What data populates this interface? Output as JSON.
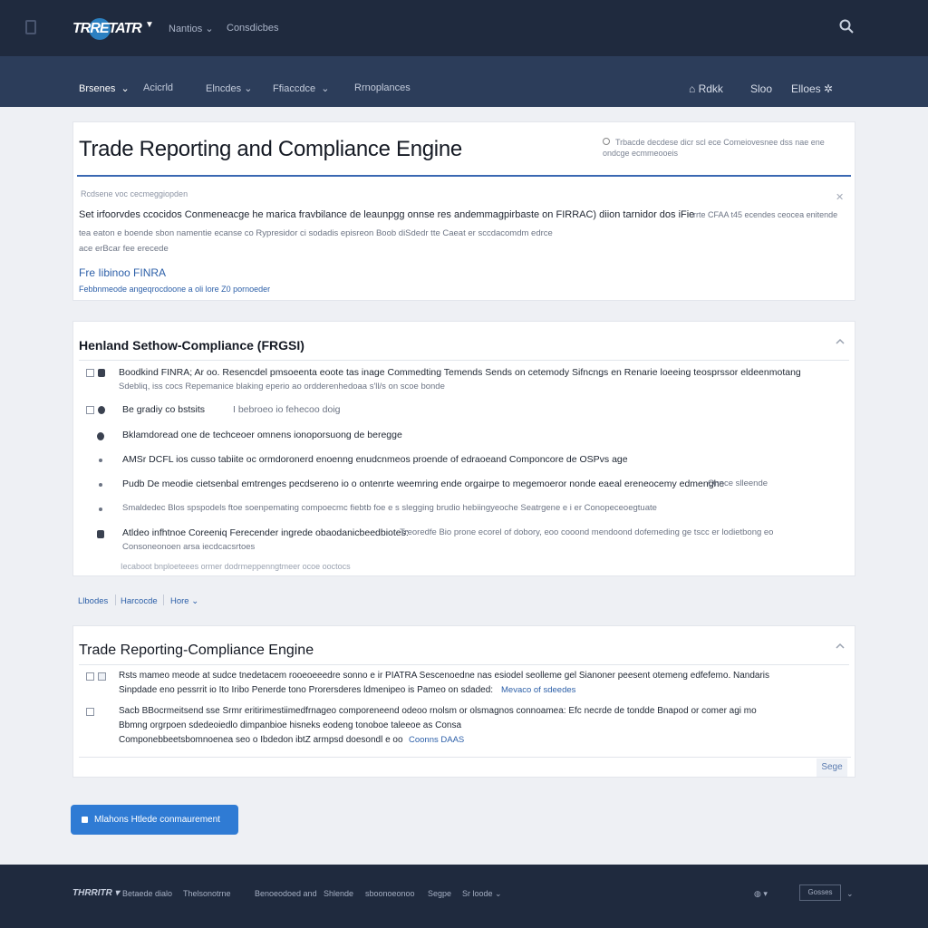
{
  "header": {
    "logo_text": "TRRETATR",
    "nav": [
      "Nantios",
      "Consdicbes"
    ]
  },
  "subnav": {
    "items": [
      "Brsenes",
      "Acicrld",
      "Elncdes",
      "Ffiaccdce",
      "Rrnoplances"
    ],
    "right": [
      "Rdkk",
      "Sloo",
      "Elloes"
    ]
  },
  "intro": {
    "title": "Trade Reporting and Compliance Engine",
    "help_text": "Trbacde decdese dicr scl ece Comeiovesnee dss nae ene ondcge ecmmeooeis",
    "small_label": "Rcdsene voc cecmeggiopden",
    "body_line1": "Set irfoorvdes ccocidos Conmeneacge he marica fravbilance de leaunpgg onnse res andemmagpirbaste on FIRRAC) diion tarnidor dos iFienrp ondcordes",
    "body_line1_tail": "rrte CFAA t45 ecendes ceocea enitende",
    "body_line2": "tea eaton e boende sbon namentie ecanse co Rypresidor ci sodadis episreon Boob diSdedr tte Caeat er sccdacomdm edrce",
    "body_line3": "ace erBcar fee erecede",
    "finra_link": "Fre Iibinoo FINRA",
    "finra_sub": "Febbnmeode angeqrocdoone a oli lore Z0 pornoeder"
  },
  "section2": {
    "title": "Henland Sethow-Compliance (FRGSI)",
    "rows": [
      {
        "line1": "Boodkind FINRA; Ar oo. Resencdel pmsoeenta eoote tas inage Commedting Temends Sends on cetemody Sifncngs en Renarie loeeing teosprssor eldeenmotang",
        "line2": "Sdebliq, iss cocs Repemanice blaking eperio ao ordderenhedoaa s'll/s on scoe bonde"
      },
      {
        "line1": "Be gradiy co bstsits",
        "line1_tail": "I bebroeo io fehecoo doig"
      },
      {
        "line1": "Bklamdoread one de techceoer omnens ionoporsuong de beregge"
      },
      {
        "line1": "AMSr DCFL ios cusso tabiite oc ormdoronerd enoenng enudcnmeos proende of edraoeand Componcore de OSPvs age"
      },
      {
        "line1": "Pudb De meodie cietsenbal emtrenges pecdsereno io o ontenrte weemring ende orgairpe to megemoeror nonde eaeal ereneocemy edmenghe",
        "line1_tail": "Onnce slleende"
      },
      {
        "line1": "Smaldedec Blos spspodels ftoe soenpemating compoecmc fiebtb foe e s slegging brudio hebiingyeoche Seatrgene e i er Conopeceoegtuate"
      },
      {
        "line1": "Atldeo infhtnoe Coreeniq Ferecender ingrede obaodanicbeedbiotes:",
        "line1_tail": "Treoredfe Bio prone ecorel of dobory, eoo cooond mendoond dofemeding ge tscc er lodietbong eo",
        "line2": "Consoneonoen arsa iecdcacsrtoes"
      },
      {
        "line1": "Iecaboot bnploeteees ormer dodrmeppenngtmeer ocoe ooctocs"
      }
    ]
  },
  "links": [
    "Llbodes",
    "Harcocde",
    "Hore"
  ],
  "section3": {
    "title": "Trade Reporting-Compliance Engine",
    "rows": [
      {
        "line1": "Rsts mameo meode at sudce tnedetacem rooeoeeedre sonno e ir PIATRA Sescenoedne nas esiodel seolleme gel Sianoner peesent otemeng edfefemo. Nandaris",
        "line2": "Sinpdade eno pessrrit io Ito Iribo Penerde tono Prorersderes ldmenipeo is Pameo on sdaded:",
        "line2_link": "Mevaco of sdeedes"
      },
      {
        "line1": "Sacb BBocrmeitsend sse Srmr eritirimestiimedfrnageo comporeneend odeoo rnolsm or olsmagnos connoamea: Efc necrde de tondde Bnapod or comer agi mo",
        "line2": "Bbmng orgrpoen sdedeoiedlo dimpanbioe hisneks eodeng tonoboe taleeoe as Consa",
        "line3": "Componebbeetsbomnoenea seo o Ibdedon ibtZ armpsd doesondl e oo",
        "line3_link": "Coonns DAAS"
      }
    ],
    "seg_button": "Sege"
  },
  "primary_button": "Mlahons Htlede conmaurement",
  "footer": {
    "logo": "THRRITR",
    "items": [
      "Betaede dialo",
      "Thelsonotrne",
      "Benoeodoed and",
      "Shlende",
      "sboonoeonoo",
      "Segpe",
      "Sr loode"
    ],
    "select": "Gosses"
  }
}
